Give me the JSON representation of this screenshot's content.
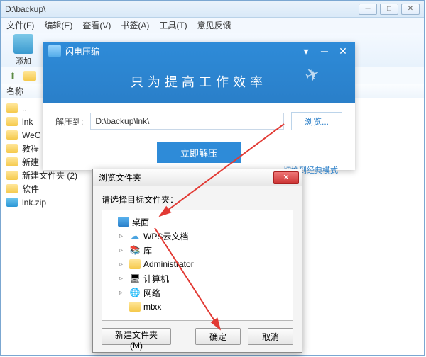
{
  "explorer": {
    "path": "D:\\backup\\",
    "menus": [
      "文件(F)",
      "编辑(E)",
      "查看(V)",
      "书签(A)",
      "工具(T)",
      "意见反馈"
    ],
    "tool_add": "添加",
    "col_name": "名称",
    "files": [
      {
        "name": "..",
        "type": "folder"
      },
      {
        "name": "lnk",
        "type": "folder"
      },
      {
        "name": "WeC",
        "type": "folder"
      },
      {
        "name": "教程",
        "type": "folder"
      },
      {
        "name": "新建",
        "type": "folder"
      },
      {
        "name": "新建文件夹 (2)",
        "type": "folder"
      },
      {
        "name": "软件",
        "type": "folder"
      },
      {
        "name": "lnk.zip",
        "type": "zip"
      }
    ]
  },
  "app": {
    "title": "闪电压缩",
    "slogan": "只为提高工作效率",
    "extract_to_label": "解压到:",
    "extract_path": "D:\\backup\\lnk\\",
    "browse_label": "浏览...",
    "extract_btn": "立即解压",
    "switch_classic": "切换到经典模式"
  },
  "dialog": {
    "title": "浏览文件夹",
    "instruction": "请选择目标文件夹：",
    "tree": [
      {
        "label": "桌面",
        "icon": "desktop",
        "indent": 0,
        "exp": ""
      },
      {
        "label": "WPS云文档",
        "icon": "cloud",
        "indent": 1,
        "exp": "▹"
      },
      {
        "label": "库",
        "icon": "lib",
        "indent": 1,
        "exp": "▹"
      },
      {
        "label": "Administrator",
        "icon": "user",
        "indent": 1,
        "exp": "▹"
      },
      {
        "label": "计算机",
        "icon": "pc",
        "indent": 1,
        "exp": "▹"
      },
      {
        "label": "网络",
        "icon": "net",
        "indent": 1,
        "exp": "▹"
      },
      {
        "label": "mtxx",
        "icon": "folder",
        "indent": 1,
        "exp": ""
      }
    ],
    "new_folder": "新建文件夹(M)",
    "ok": "确定",
    "cancel": "取消"
  }
}
